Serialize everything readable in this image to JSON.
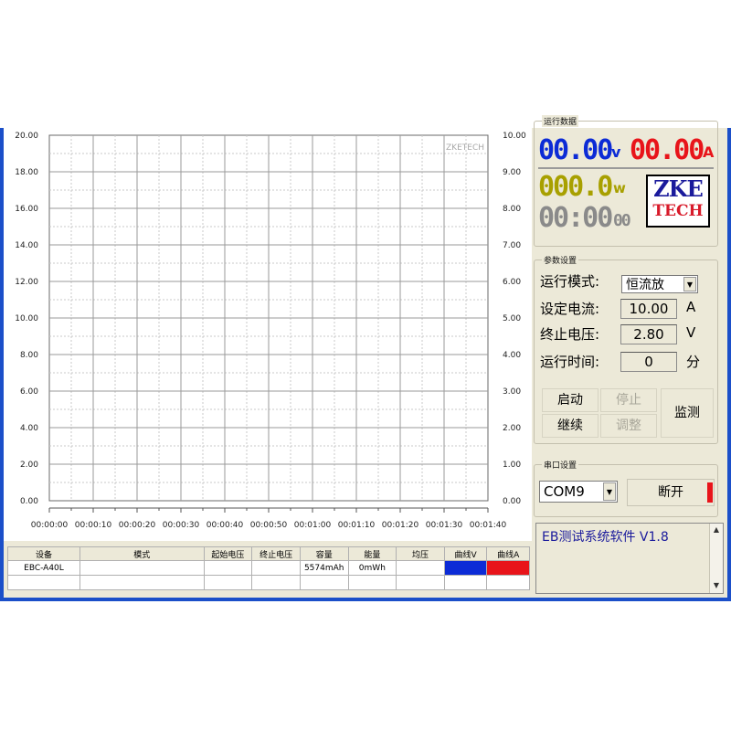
{
  "colors": {
    "voltage": "#0c2bd6",
    "current": "#e8141a",
    "power": "#a8a000",
    "time": "#8a8a8a",
    "window_frame": "#1b4fc9"
  },
  "chart_data": {
    "type": "line",
    "watermark": "ZKETECH",
    "x_ticks": [
      "00:00:00",
      "00:00:10",
      "00:00:20",
      "00:00:30",
      "00:00:40",
      "00:00:50",
      "00:01:00",
      "00:01:10",
      "00:01:20",
      "00:01:30",
      "00:01:40"
    ],
    "y_left_ticks": [
      "0.00",
      "2.00",
      "4.00",
      "6.00",
      "8.00",
      "10.00",
      "12.00",
      "14.00",
      "16.00",
      "18.00",
      "20.00"
    ],
    "y_right_ticks": [
      "0.00",
      "1.00",
      "2.00",
      "3.00",
      "4.00",
      "5.00",
      "6.00",
      "7.00",
      "8.00",
      "9.00",
      "10.00"
    ],
    "y_left_range": [
      0,
      20
    ],
    "y_right_range": [
      0,
      10
    ],
    "x_range_seconds": [
      0,
      100
    ],
    "grid": true,
    "series": []
  },
  "table": {
    "headers": [
      "设备",
      "模式",
      "起始电压",
      "终止电压",
      "容量",
      "能量",
      "均压",
      "曲线V",
      "曲线A"
    ],
    "rows": [
      [
        "EBC-A40L",
        "",
        "",
        "",
        "5574mAh",
        "0mWh",
        "",
        "",
        ""
      ]
    ]
  },
  "status": {
    "title": "运行数据",
    "voltage": "00.00",
    "voltage_unit": "v",
    "current": "00.00",
    "current_unit": "A",
    "power": "000.0",
    "power_unit": "w",
    "time": "00:00",
    "time_sec": "00"
  },
  "logo": {
    "line1": "ZKE",
    "line2": "TECH"
  },
  "params": {
    "title": "参数设置",
    "mode_label": "运行模式:",
    "mode_value": "恒流放",
    "current_label": "设定电流:",
    "current_value": "10.00",
    "current_unit": "A",
    "cutoff_label": "终止电压:",
    "cutoff_value": "2.80",
    "cutoff_unit": "V",
    "runtime_label": "运行时间:",
    "runtime_value": "0",
    "runtime_unit": "分",
    "start": "启动",
    "stop": "停止",
    "continue": "继续",
    "adjust": "调整",
    "monitor": "监测"
  },
  "serial": {
    "title": "串口设置",
    "port": "COM9",
    "disconnect": "断开"
  },
  "info": {
    "text": "EB测试系统软件 V1.8"
  }
}
